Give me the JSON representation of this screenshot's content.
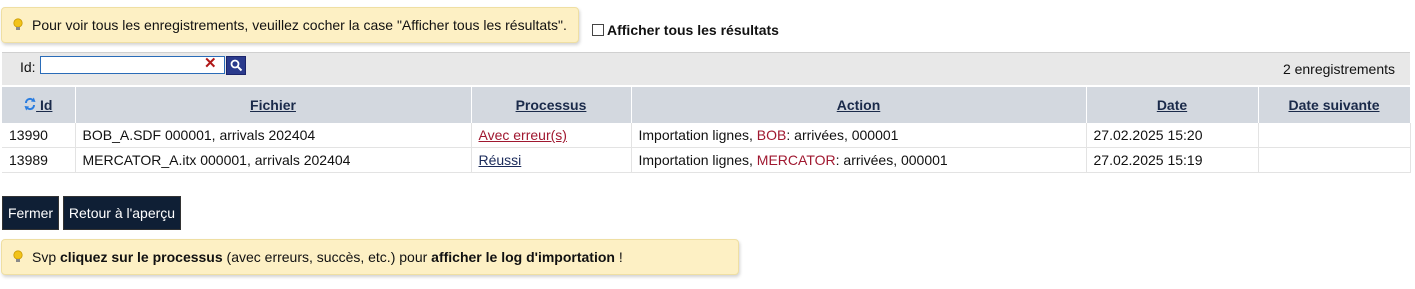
{
  "notice_top": {
    "text": "Pour voir tous les enregistrements, veuillez cocher la case \"Afficher tous les résultats\"."
  },
  "show_all": {
    "label": "Afficher tous les résultats",
    "checked": false
  },
  "filter": {
    "id_label": "Id:",
    "id_value": "",
    "record_count": "2 enregistrements"
  },
  "table": {
    "headers": [
      "Id",
      "Fichier",
      "Processus",
      "Action",
      "Date",
      "Date suivante"
    ],
    "rows": [
      {
        "id": "13990",
        "fichier": "BOB_A.SDF 000001, arrivals 202404",
        "processus": "Avec erreur(s)",
        "action_prefix": "Importation lignes, ",
        "action_name": "BOB",
        "action_suffix": ": arrivées, 000001",
        "date": "27.02.2025 15:20",
        "date_suivante": ""
      },
      {
        "id": "13989",
        "fichier": "MERCATOR_A.itx 000001, arrivals 202404",
        "processus": "Réussi",
        "action_prefix": "Importation lignes, ",
        "action_name": "MERCATOR",
        "action_suffix": ": arrivées, 000001",
        "date": "27.02.2025 15:19",
        "date_suivante": ""
      }
    ]
  },
  "buttons": {
    "close": "Fermer",
    "back": "Retour à l'aperçu"
  },
  "notice_bottom": {
    "part1": "Svp ",
    "bold1": "cliquez sur le processus",
    "part2": " (avec erreurs, succès, etc.) pour ",
    "bold2": "afficher le log d'importation",
    "part3": " !"
  },
  "colors": {
    "notice_bg": "#fdf0c4",
    "header_bg": "#d3d8df",
    "error_link": "#a01830",
    "button_bg": "#0f1f35"
  },
  "icons": [
    "lightbulb-icon",
    "refresh-icon",
    "clear-icon",
    "search-icon"
  ]
}
